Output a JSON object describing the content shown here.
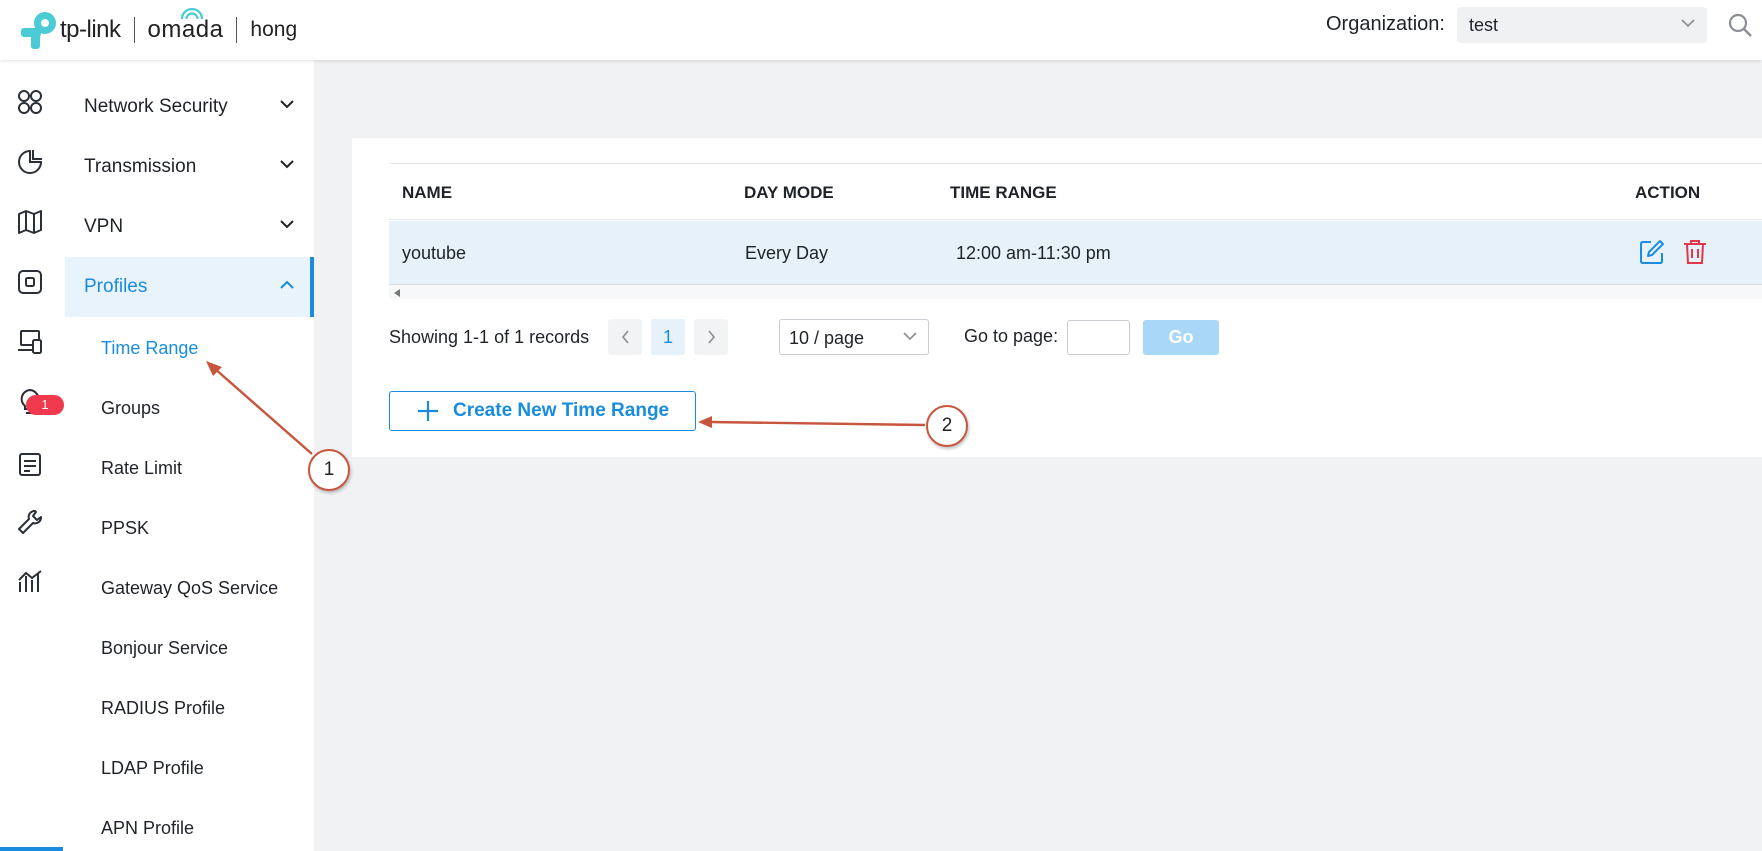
{
  "header": {
    "brand": "tp-link",
    "product": "omada",
    "site": "hong",
    "org_label": "Organization:",
    "org_value": "test"
  },
  "iconbar": {
    "icons": [
      "dashboard-icon",
      "statistics-icon",
      "map-icon",
      "devices-icon",
      "clients-icon",
      "insight-icon",
      "log-icon",
      "tools-icon",
      "reports-icon"
    ],
    "log_badge": "1"
  },
  "sidebar": {
    "sections": [
      {
        "label": "Network Security",
        "expanded": false
      },
      {
        "label": "Transmission",
        "expanded": false
      },
      {
        "label": "VPN",
        "expanded": false
      },
      {
        "label": "Profiles",
        "expanded": true
      }
    ],
    "profile_items": [
      "Time Range",
      "Groups",
      "Rate Limit",
      "PPSK",
      "Gateway QoS Service",
      "Bonjour Service",
      "RADIUS Profile",
      "LDAP Profile",
      "APN Profile"
    ],
    "active_item": "Time Range"
  },
  "table": {
    "columns": [
      "NAME",
      "DAY MODE",
      "TIME RANGE",
      "ACTION"
    ],
    "rows": [
      {
        "name": "youtube",
        "day_mode": "Every Day",
        "time_range": "12:00 am-11:30 pm"
      }
    ]
  },
  "pagination": {
    "showing": "Showing 1-1 of 1 records",
    "current_page": "1",
    "per_page": "10 / page",
    "goto_label": "Go to page:",
    "go_label": "Go"
  },
  "create_button": {
    "label": "Create New Time Range"
  },
  "callouts": [
    "1",
    "2"
  ],
  "colors": {
    "accent": "#1a8ce0",
    "annotation": "#c8553d",
    "danger": "#e0374a"
  }
}
